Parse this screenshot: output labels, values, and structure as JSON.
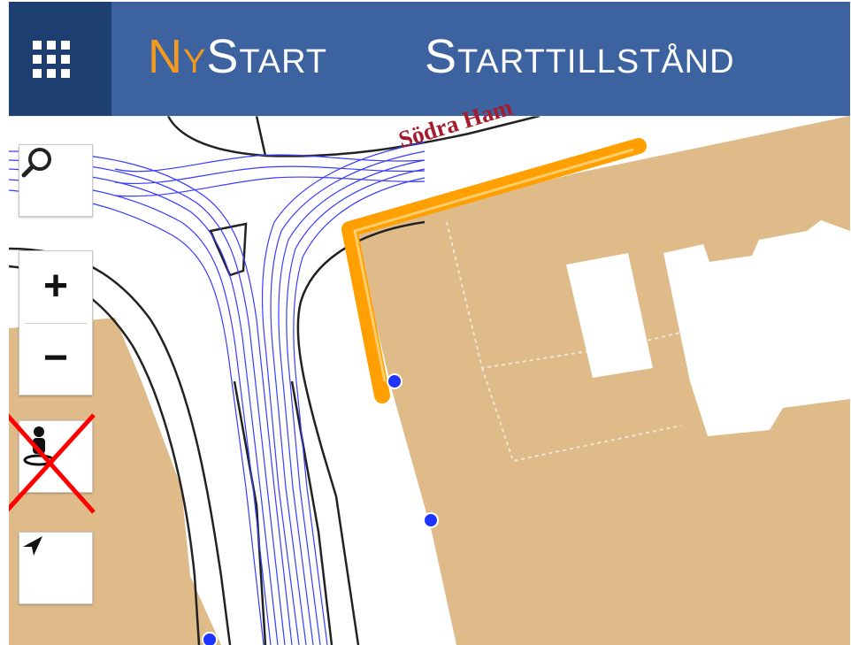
{
  "header": {
    "menu_icon": "grid-icon",
    "brand_prefix": "Ny",
    "brand_suffix": "Start",
    "title": "Starttillstånd"
  },
  "map": {
    "street_label": "Södra Ham",
    "controls": {
      "search_icon": "search-icon",
      "zoom_in_label": "+",
      "zoom_out_label": "−",
      "streetview_icon": "pegman-icon",
      "streetview_state": "disabled",
      "locate_icon": "locate-arrow-icon"
    },
    "colors": {
      "header": "#3c63a0",
      "menu_button": "#1e3f72",
      "brand_accent": "#f39a1e",
      "building": "#debb89",
      "highlight_route": "#ffa000",
      "tram_lines": "#3a3cff",
      "street_label": "#a41c2c",
      "disabled_cross": "#ff0000"
    }
  }
}
